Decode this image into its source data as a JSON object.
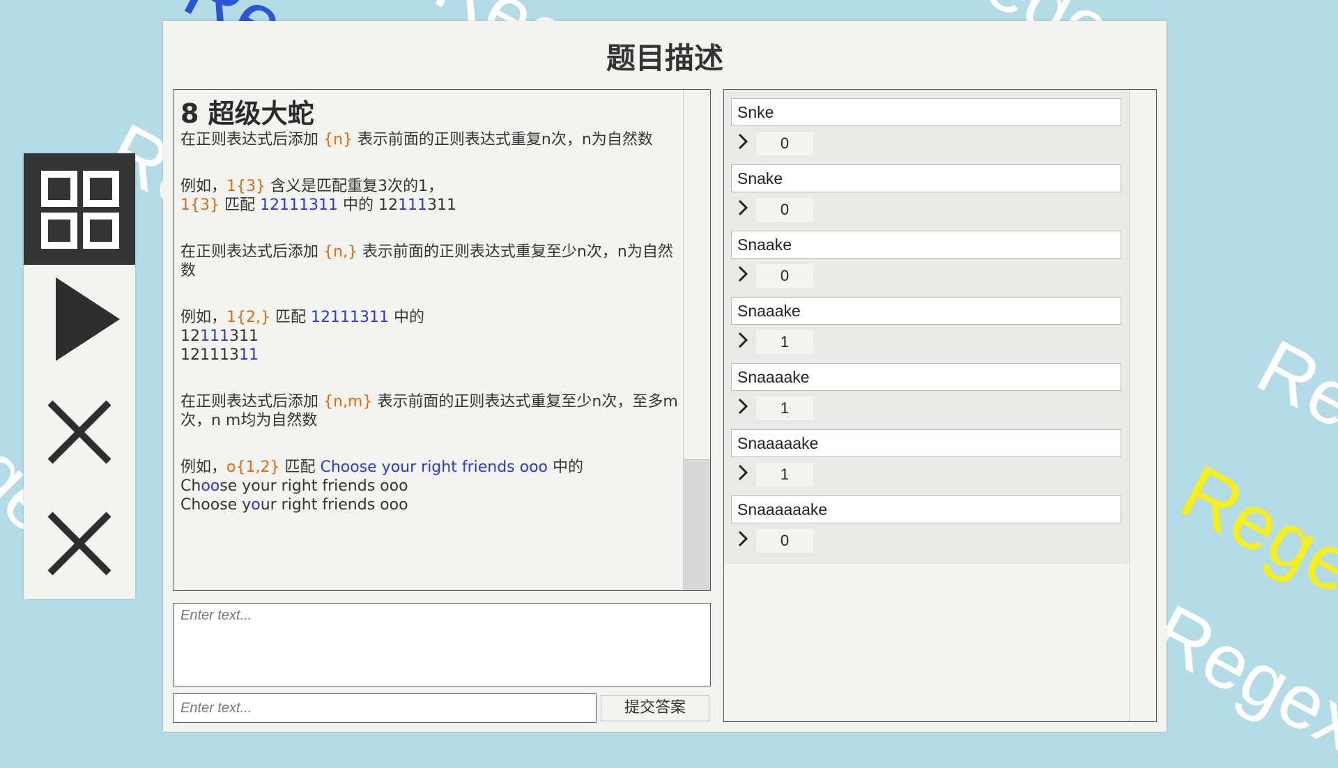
{
  "background_words": [
    "Regex",
    "Regex",
    "Regex",
    "Regex",
    "Regex",
    "Regex",
    "Regex",
    "Regex"
  ],
  "panel": {
    "title": "题目描述"
  },
  "toolbar": {
    "icons": [
      "grid-menu-icon",
      "play-icon",
      "close-icon",
      "close-icon"
    ]
  },
  "description": {
    "heading": "8 超级大蛇",
    "p1": {
      "a": "在正则表达式后添加 ",
      "b": "{n}",
      "c": " 表示前面的正则表达式重复n次，n为自然数"
    },
    "p2": {
      "line1": {
        "a": "例如，",
        "b": "1{3}",
        "c": " 含义是匹配重复3次的1，"
      },
      "line2": {
        "a": "1{3}",
        "b": " 匹配 ",
        "c": "12111311",
        "d": " 中的 12",
        "e": "111",
        "f": "311"
      }
    },
    "p3": {
      "a": "在正则表达式后添加 ",
      "b": "{n,}",
      "c": " 表示前面的正则表达式重复至少n次，n为自然数"
    },
    "p4": {
      "line1": {
        "a": "例如，",
        "b": "1{2,}",
        "c": " 匹配 ",
        "d": "12111311",
        "e": " 中的"
      },
      "line2": {
        "a": "12",
        "b": "111",
        "c": "311"
      },
      "line3": {
        "a": "121113",
        "b": "11"
      }
    },
    "p5": {
      "a": "在正则表达式后添加 ",
      "b": "{n,m}",
      "c": " 表示前面的正则表达式重复至少n次，至多m次，n m均为自然数"
    },
    "p6": {
      "line1": {
        "a": "例如，",
        "b": "o{1,2}",
        "c": " 匹配 ",
        "d": "Choose your right friends ooo",
        "e": " 中的"
      },
      "line2": {
        "a": "Ch",
        "b": "oo",
        "c": "se your right friends ooo"
      },
      "line3": {
        "a": "Choose y",
        "b": "o",
        "c": "ur right friends ooo"
      }
    }
  },
  "answer": {
    "area_placeholder": "Enter text...",
    "input_placeholder": "Enter text...",
    "submit_label": "提交答案"
  },
  "tests": [
    {
      "word": "Snke",
      "count": "0"
    },
    {
      "word": "Snake",
      "count": "0"
    },
    {
      "word": "Snaake",
      "count": "0"
    },
    {
      "word": "Snaaake",
      "count": "1"
    },
    {
      "word": "Snaaaake",
      "count": "1"
    },
    {
      "word": "Snaaaaake",
      "count": "1"
    },
    {
      "word": "Snaaaaaake",
      "count": "0"
    }
  ],
  "colors": {
    "background": "#b3dce6",
    "panel": "#f3f3ef",
    "pattern_orange": "#e06a0e",
    "match_blue": "#2a36e0",
    "watermark_blue": "#2a55d6",
    "watermark_yellow": "#f7ef1c"
  }
}
